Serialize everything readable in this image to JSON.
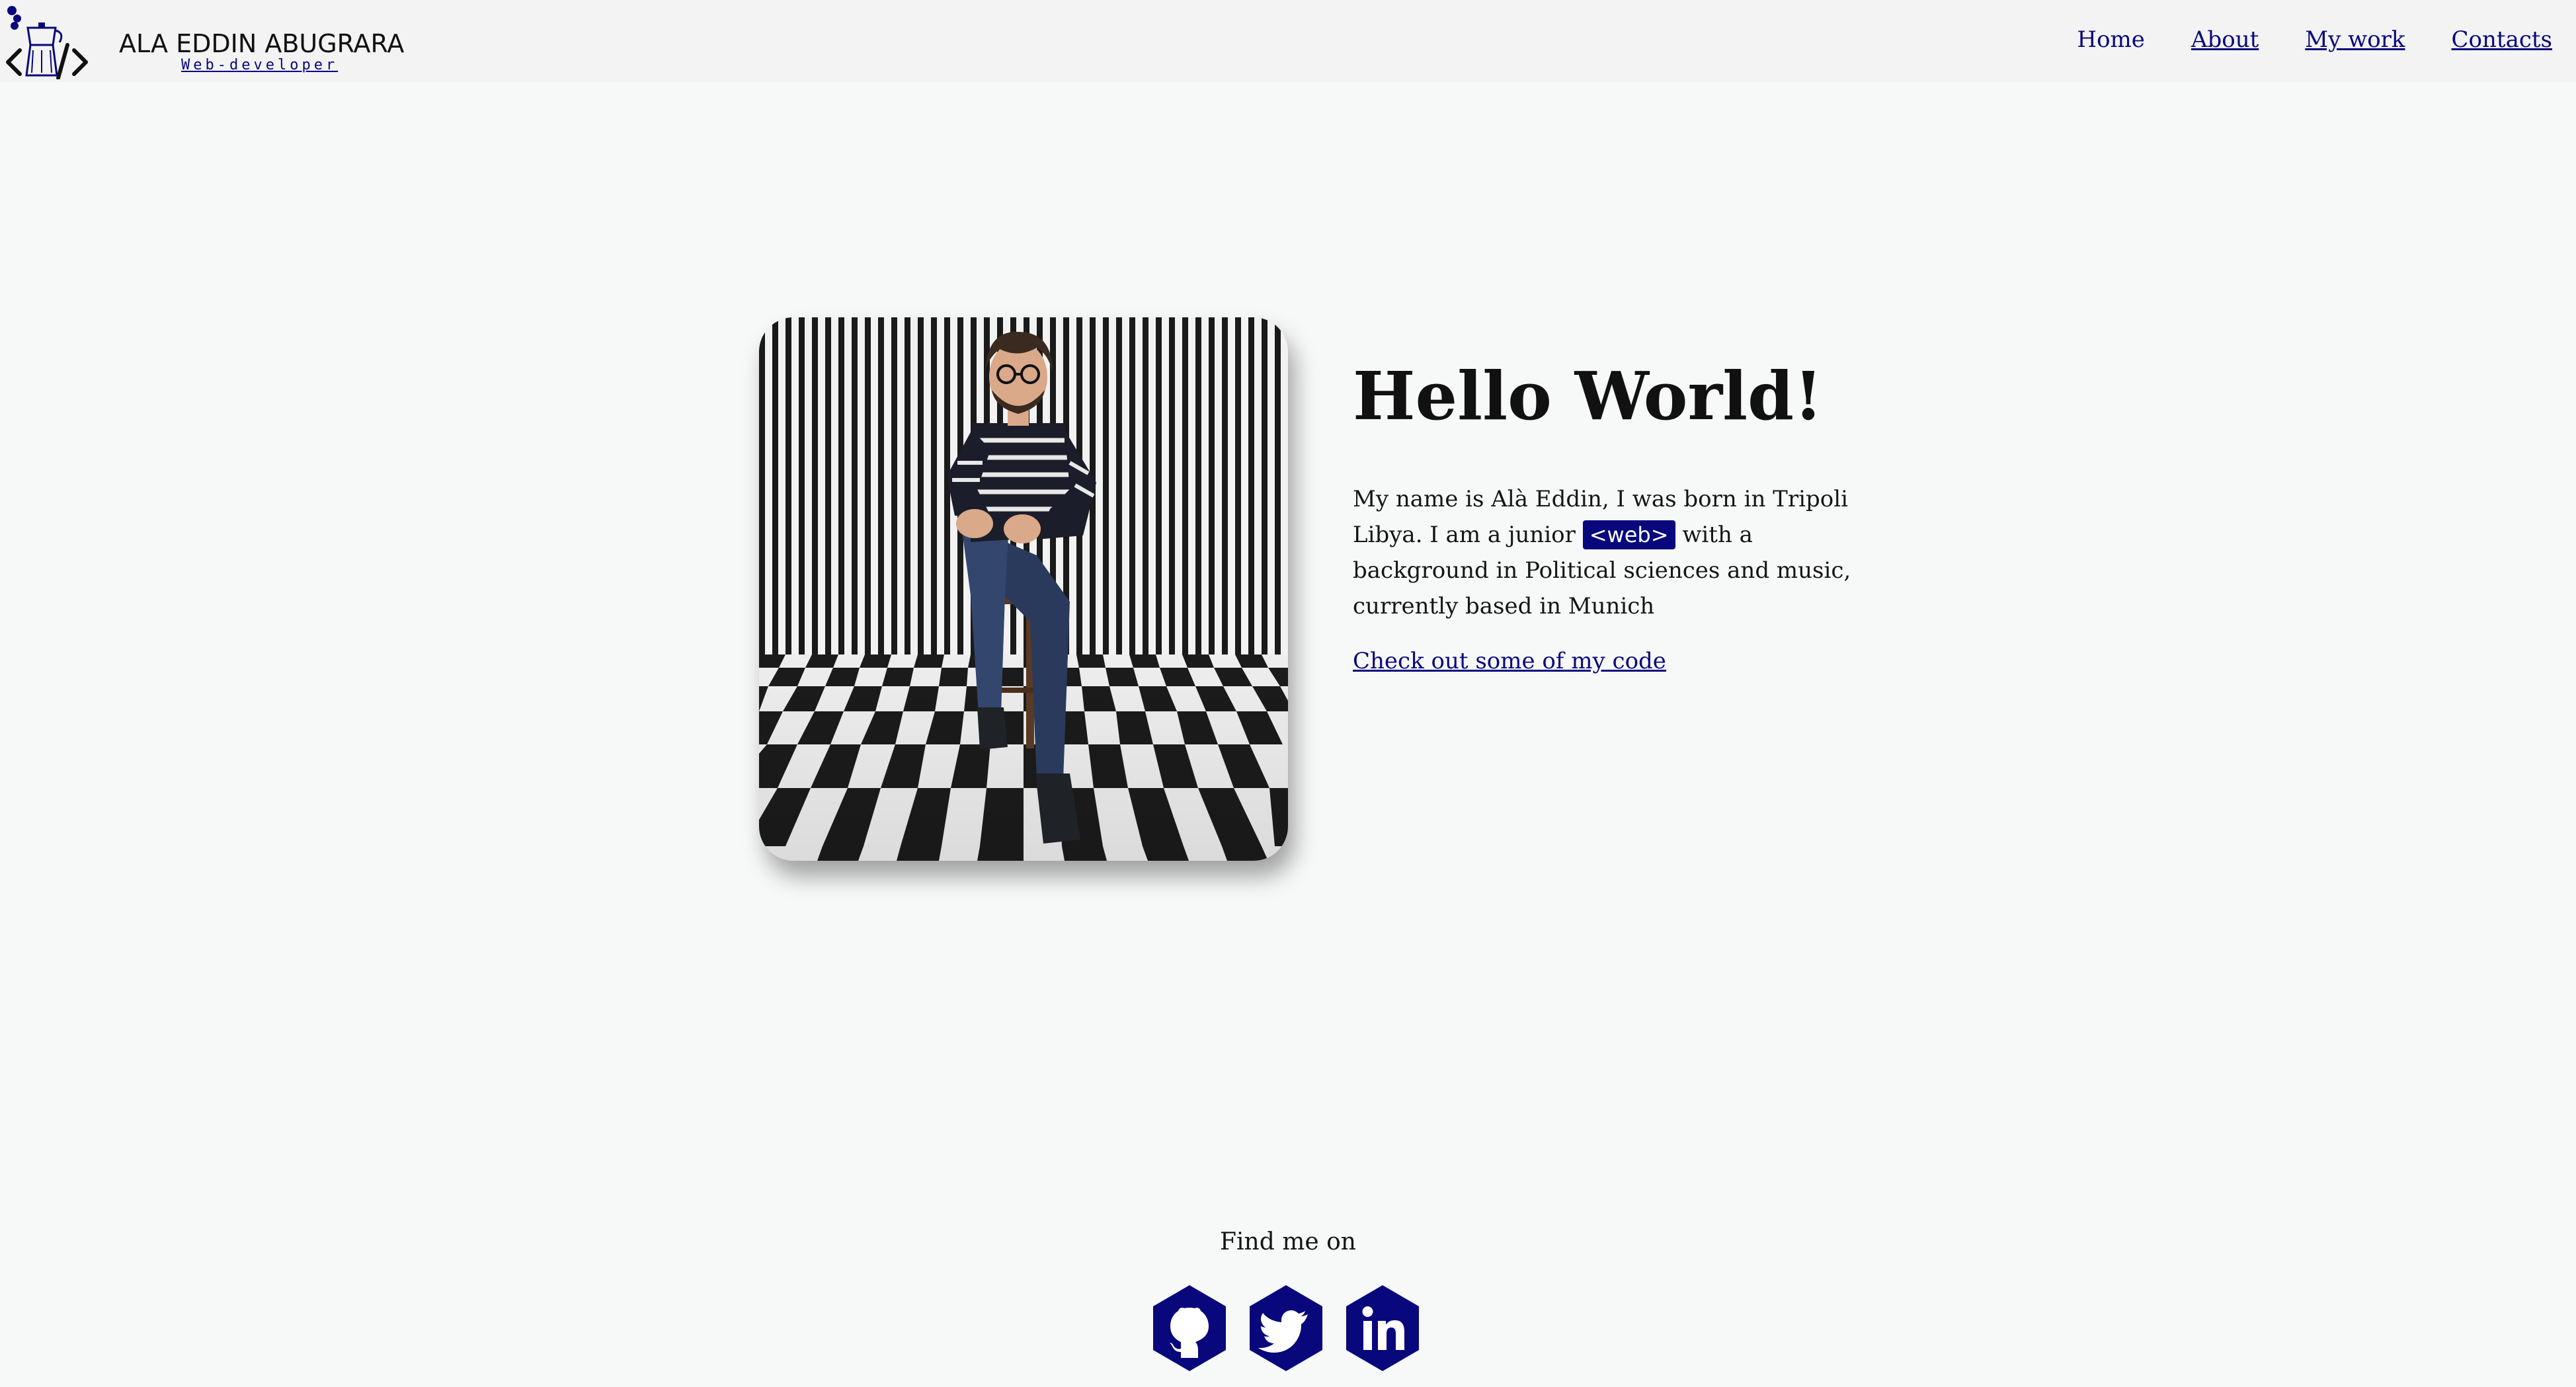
{
  "header": {
    "brand_name": "ALA EDDIN ABUGRARA",
    "brand_subtitle": "Web-developer",
    "nav": [
      {
        "label": "Home"
      },
      {
        "label": "About"
      },
      {
        "label": "My work"
      },
      {
        "label": "Contacts"
      }
    ]
  },
  "hero": {
    "title": "Hello World!",
    "intro_part1": "My name is Alà Eddin, I was born in Tripoli Libya. I am a junior",
    "badge": "<web>",
    "intro_part2": "with a background in Political sciences and music, currently based in Munich",
    "link": "Check out some of my code"
  },
  "footer": {
    "find_me": "Find me on",
    "socials": [
      {
        "icon": "github-icon"
      },
      {
        "icon": "twitter-icon"
      },
      {
        "icon": "linkedin-icon"
      }
    ]
  },
  "colors": {
    "accent": "#08087c",
    "background": "#f7f8f8",
    "header_bg": "#f3f3f3"
  }
}
